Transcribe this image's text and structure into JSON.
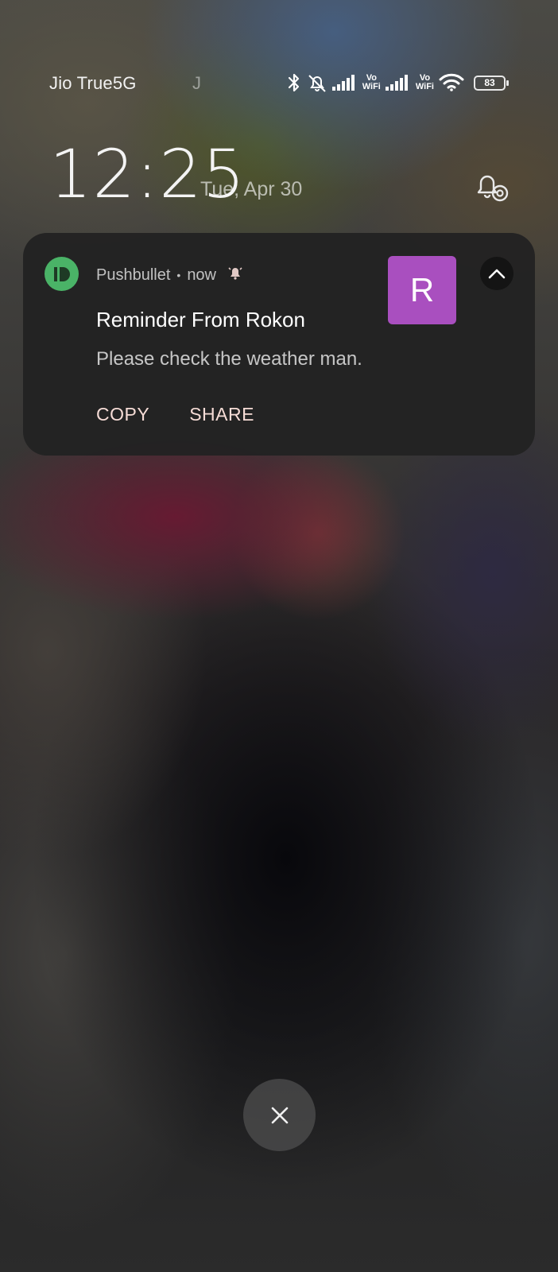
{
  "status_bar": {
    "carrier_primary": "Jio True5G",
    "carrier_secondary": "J",
    "icons": [
      "bluetooth-icon",
      "bell-off-icon",
      "signal-bars-icon",
      "vowifi-icon",
      "signal-bars-icon",
      "vowifi-icon",
      "wifi-icon",
      "battery-icon"
    ],
    "vowifi_label_top": "Vo",
    "vowifi_label_bottom": "WiFi",
    "battery_level": "83"
  },
  "lock_screen": {
    "time": "12:25",
    "date": "Tue, Apr 30"
  },
  "notification": {
    "app_name": "Pushbullet",
    "separator": "•",
    "time": "now",
    "app_icon_color": "#4ab367",
    "avatar_letter": "R",
    "avatar_color": "#a94fbf",
    "title": "Reminder From Rokon",
    "body": "Please check the weather man.",
    "actions": [
      {
        "label": "COPY"
      },
      {
        "label": "SHARE"
      }
    ]
  }
}
